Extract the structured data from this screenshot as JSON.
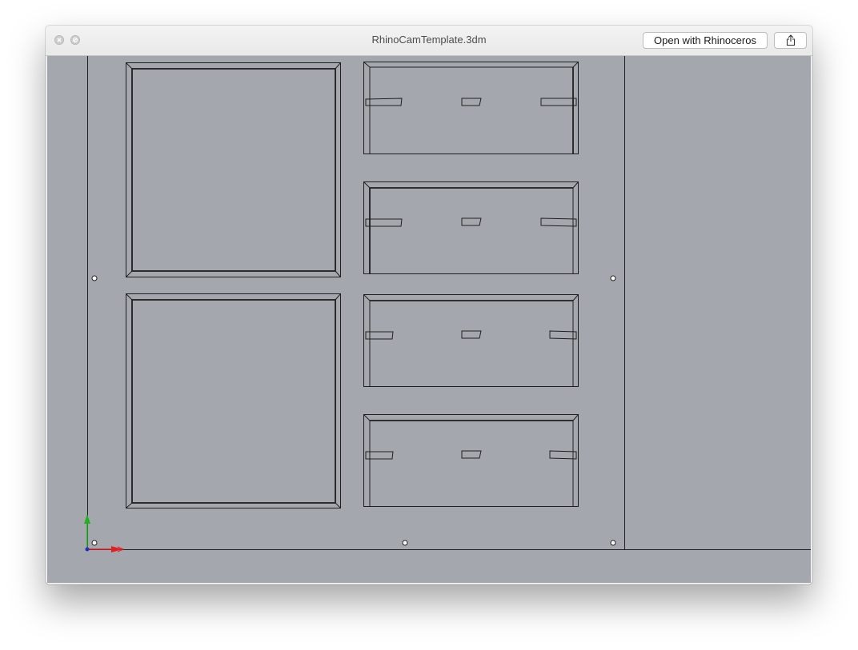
{
  "window": {
    "title": "RhinoCamTemplate.3dm",
    "open_button_label": "Open with Rhinoceros",
    "share_icon": "share-icon",
    "close_icon": "close-icon",
    "minimize_icon": "minimize-icon"
  },
  "viewport": {
    "background_color": "#a4a8ae",
    "line_color": "#1f1f1f",
    "axis_x_color": "#e02020",
    "axis_y_color": "#22b022",
    "axis_icon": "world-axes-icon"
  }
}
